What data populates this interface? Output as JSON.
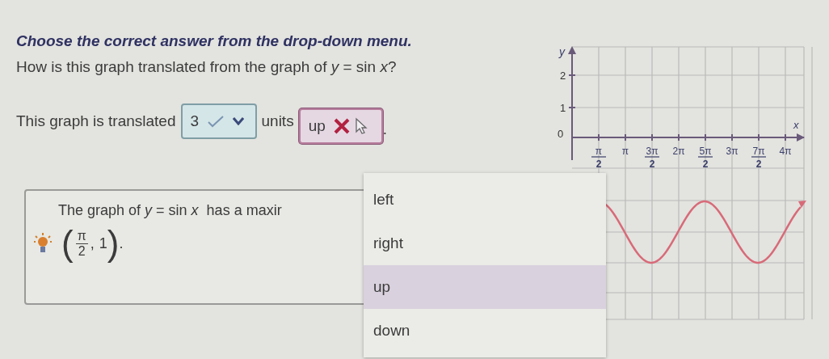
{
  "instruction": "Choose the correct answer from the drop-down menu.",
  "question": "How is this graph translated from the graph of *y* = sin *x*?",
  "answer_line": {
    "prefix": "This graph is translated",
    "middle": "units",
    "suffix": "."
  },
  "dropdowns": [
    {
      "value": "3",
      "correct": true,
      "open": false
    },
    {
      "value": "up",
      "correct": false,
      "open": true,
      "options": [
        {
          "label": "left",
          "selected": false
        },
        {
          "label": "right",
          "selected": false
        },
        {
          "label": "up",
          "selected": true
        },
        {
          "label": "down",
          "selected": false
        }
      ]
    }
  ],
  "hint": {
    "text": "The graph of *y* = sin *x*  has a maxir",
    "point": {
      "open": "(",
      "numerator": "π",
      "denominator": "2",
      "separator": ",",
      "value": "1",
      "close": ")",
      "end": "."
    }
  },
  "graph": {
    "y_label": "y",
    "x_label": "x",
    "y_ticks": [
      "2",
      "1",
      "0"
    ],
    "x_ticks": [
      {
        "numerator": "π",
        "denominator": "2"
      },
      {
        "label": "π"
      },
      {
        "numerator": "3π",
        "denominator": "2"
      },
      {
        "label": "2π"
      },
      {
        "numerator": "5π",
        "denominator": "2"
      },
      {
        "label": "3π"
      },
      {
        "numerator": "7π",
        "denominator": "2"
      },
      {
        "label": "4π"
      }
    ]
  }
}
